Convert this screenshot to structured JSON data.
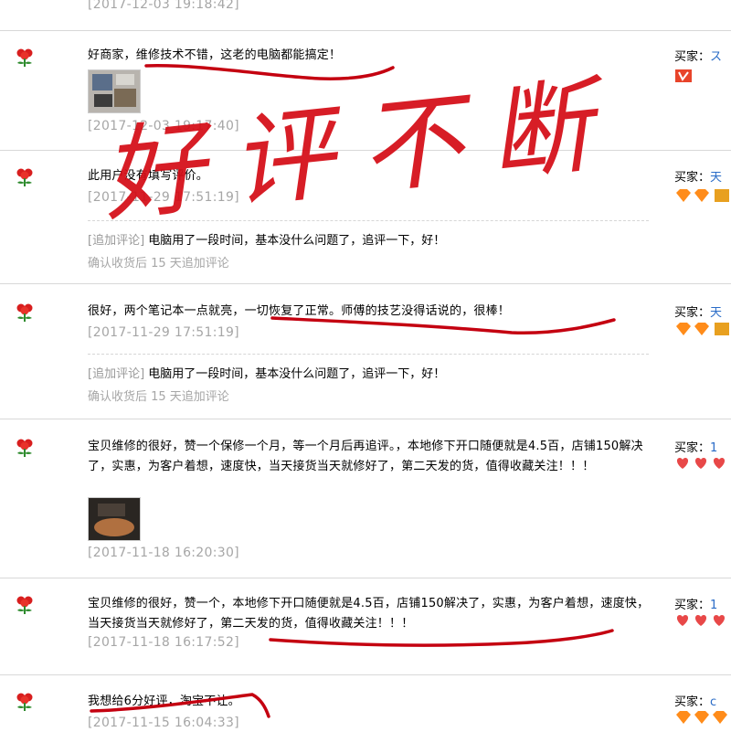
{
  "top_date": "[2017-12-03 19:18:42]",
  "buyer_label": "买家：",
  "add_label": "[追加评论]",
  "overlay_text": "好评不断",
  "reviews": [
    {
      "text": "好商家，维修技术不错，这老的电脑都能搞定！",
      "date": "[2017-12-03 19:17:40]",
      "nick": "ス",
      "has_photo": true
    },
    {
      "text": "此用户没有填写评价。",
      "date": "[2017-11-29 17:51:19]",
      "nick": "天",
      "append_text": "电脑用了一段时间，基本没什么问题了，追评一下，好！",
      "confirm": "确认收货后 15 天追加评论"
    },
    {
      "text": "很好，两个笔记本一点就亮，一切恢复了正常。师傅的技艺没得话说的，很棒！",
      "date": "[2017-11-29 17:51:19]",
      "nick": "天",
      "append_text": "电脑用了一段时间，基本没什么问题了，追评一下，好！",
      "confirm": "确认收货后 15 天追加评论"
    },
    {
      "text": "宝贝维修的很好，赞一个保修一个月，等一个月后再追评。，本地修下开口随便就是4.5百，店铺150解决了，实惠，为客户着想，速度快，当天接货当天就修好了，第二天发的货，值得收藏关注！！！",
      "date": "[2017-11-18 16:20:30]",
      "nick": "1",
      "has_photo": true
    },
    {
      "text": "宝贝维修的很好，赞一个，本地修下开口随便就是4.5百，店铺150解决了，实惠，为客户着想，速度快，当天接货当天就修好了，第二天发的货，值得收藏关注！！！",
      "date": "[2017-11-18 16:17:52]",
      "nick": "1"
    },
    {
      "text": "我想给6分好评，淘宝不让。",
      "date": "[2017-11-15 16:04:33]",
      "nick": "c"
    }
  ]
}
